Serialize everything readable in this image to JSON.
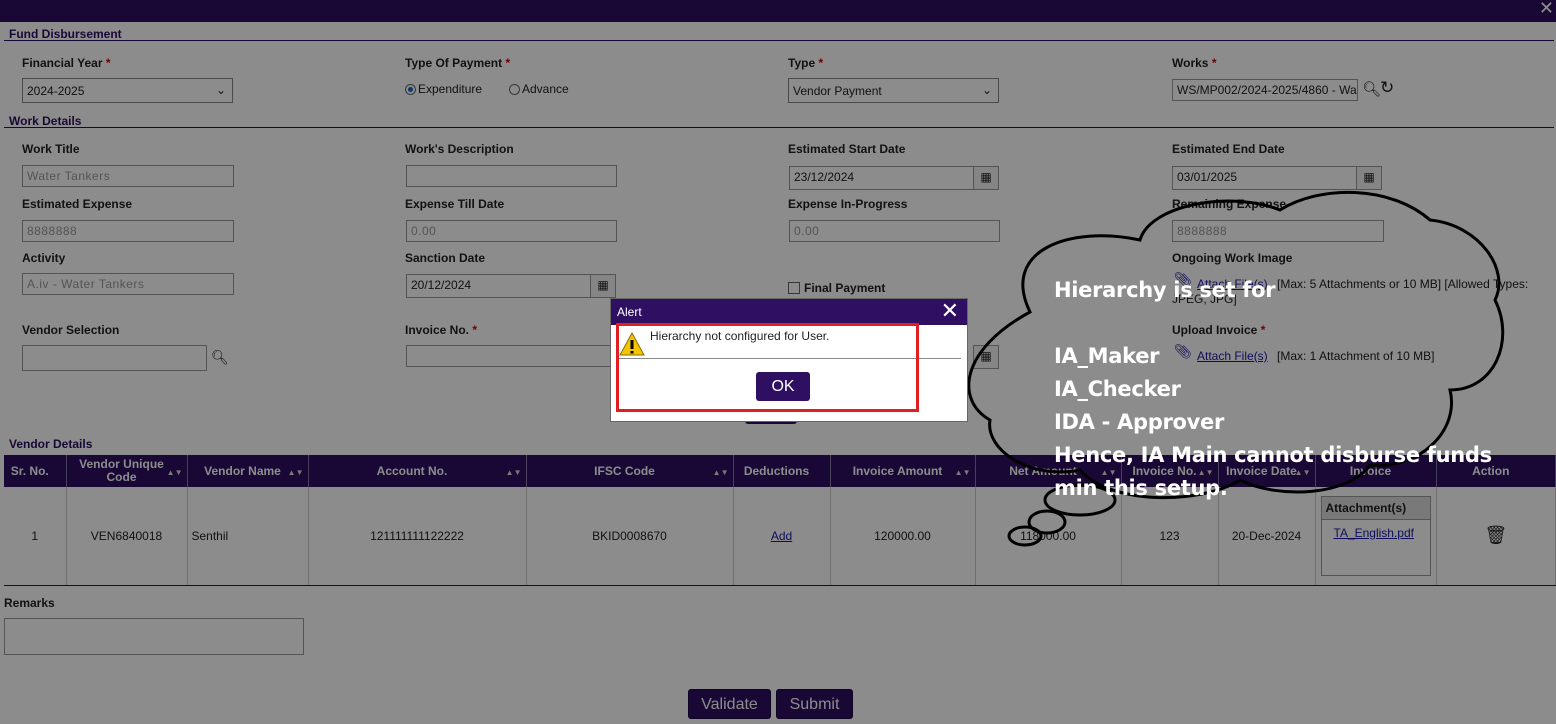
{
  "window": {
    "title": "Fund Disbursement"
  },
  "sections": {
    "fund": "Fund Disbursement",
    "work": "Work Details",
    "vendor": "Vendor Details"
  },
  "fields": {
    "financial_year": {
      "label": "Financial Year",
      "value": "2024-2025"
    },
    "type_of_payment": {
      "label": "Type Of Payment",
      "option1": "Expenditure",
      "option2": "Advance",
      "selected": "Expenditure"
    },
    "type": {
      "label": "Type",
      "value": "Vendor Payment"
    },
    "works": {
      "label": "Works",
      "value": "WS/MP002/2024-2025/4860 - Wa"
    },
    "work_title": {
      "label": "Work Title",
      "value": "Water Tankers"
    },
    "work_description": {
      "label": "Work's Description",
      "value": ""
    },
    "est_start": {
      "label": "Estimated Start Date",
      "value": "23/12/2024"
    },
    "est_end": {
      "label": "Estimated End Date",
      "value": "03/01/2025"
    },
    "est_expense": {
      "label": "Estimated Expense",
      "value": "8888888"
    },
    "expense_till": {
      "label": "Expense Till Date",
      "value": "0.00"
    },
    "expense_progress": {
      "label": "Expense In-Progress",
      "value": "0.00"
    },
    "remaining": {
      "label": "Remaining Expense",
      "value": "8888888"
    },
    "activity": {
      "label": "Activity",
      "value": "A.iv - Water Tankers"
    },
    "sanction_date": {
      "label": "Sanction Date",
      "value": "20/12/2024"
    },
    "final_payment": {
      "label": "Final Payment"
    },
    "ongoing_image": {
      "label": "Ongoing Work Image",
      "link": "Attach File(s)",
      "note": "[Max: 5 Attachments or 10 MB] [Allowed Types:",
      "note2": "JPEG, JPG]"
    },
    "vendor_selection": {
      "label": "Vendor Selection",
      "value": ""
    },
    "invoice_no": {
      "label": "Invoice No.",
      "value": ""
    },
    "upload_invoice": {
      "label": "Upload Invoice",
      "link": "Attach File(s)",
      "note": "[Max: 1 Attachment of 10 MB]"
    },
    "remarks": {
      "label": "Remarks",
      "value": ""
    }
  },
  "table": {
    "headers": [
      "Sr. No.",
      "Vendor Unique Code",
      "Vendor Name",
      "Account No.",
      "IFSC Code",
      "Deductions",
      "Invoice Amount",
      "Net Amount",
      "Invoice No.",
      "Invoice Date",
      "Invoice",
      "Action"
    ],
    "rows": [
      {
        "sr": "1",
        "code": "VEN6840018",
        "name": "Senthil",
        "account": "121111111122222",
        "ifsc": "BKID0008670",
        "deductions": "Add",
        "invoice_amount": "120000.00",
        "net_amount": "118000.00",
        "invoice_no": "123",
        "invoice_date": "20-Dec-2024",
        "attachments_label": "Attachment(s)",
        "attachment_file": "TA_English.pdf"
      }
    ]
  },
  "buttons": {
    "validate": "Validate",
    "submit": "Submit"
  },
  "dialog": {
    "title": "Alert",
    "message": "Hierarchy not configured for User.",
    "ok": "OK"
  },
  "annotation": {
    "text": "Hierarchy is set for\n\nIA_Maker\nIA_Checker\nIDA - Approver\nHence, IA Main cannot disburse funds\nmin this setup."
  },
  "colors": {
    "brand": "#2e0f62",
    "highlight": "#e02020",
    "required": "#cc0000"
  }
}
